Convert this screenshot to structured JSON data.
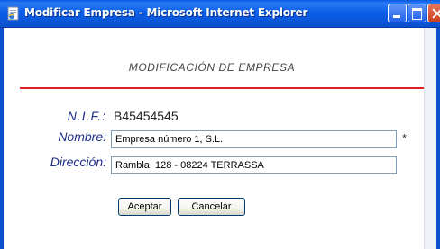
{
  "window": {
    "title": "Modificar Empresa - Microsoft Internet Explorer",
    "icon": "ie-page-icon",
    "controls": [
      "minimize-icon",
      "maximize-icon",
      "close-icon"
    ],
    "colors": {
      "titlebar": "#0a5ae6",
      "close": "#c8401e"
    }
  },
  "form": {
    "heading": "MODIFICACIÓN DE EMPRESA",
    "rule_color": "#e02020",
    "nif_label": "N.I.F.:",
    "nif_value": "B45454545",
    "nombre_label": "Nombre:",
    "nombre_value": "Empresa número 1, S.L.",
    "required_mark": "*",
    "direccion_label": "Dirección:",
    "direccion_value": "Rambla, 128 - 08224 TERRASSA",
    "label_color": "#1f2f8a"
  },
  "buttons": {
    "accept_label": "Aceptar",
    "cancel_label": "Cancelar"
  }
}
